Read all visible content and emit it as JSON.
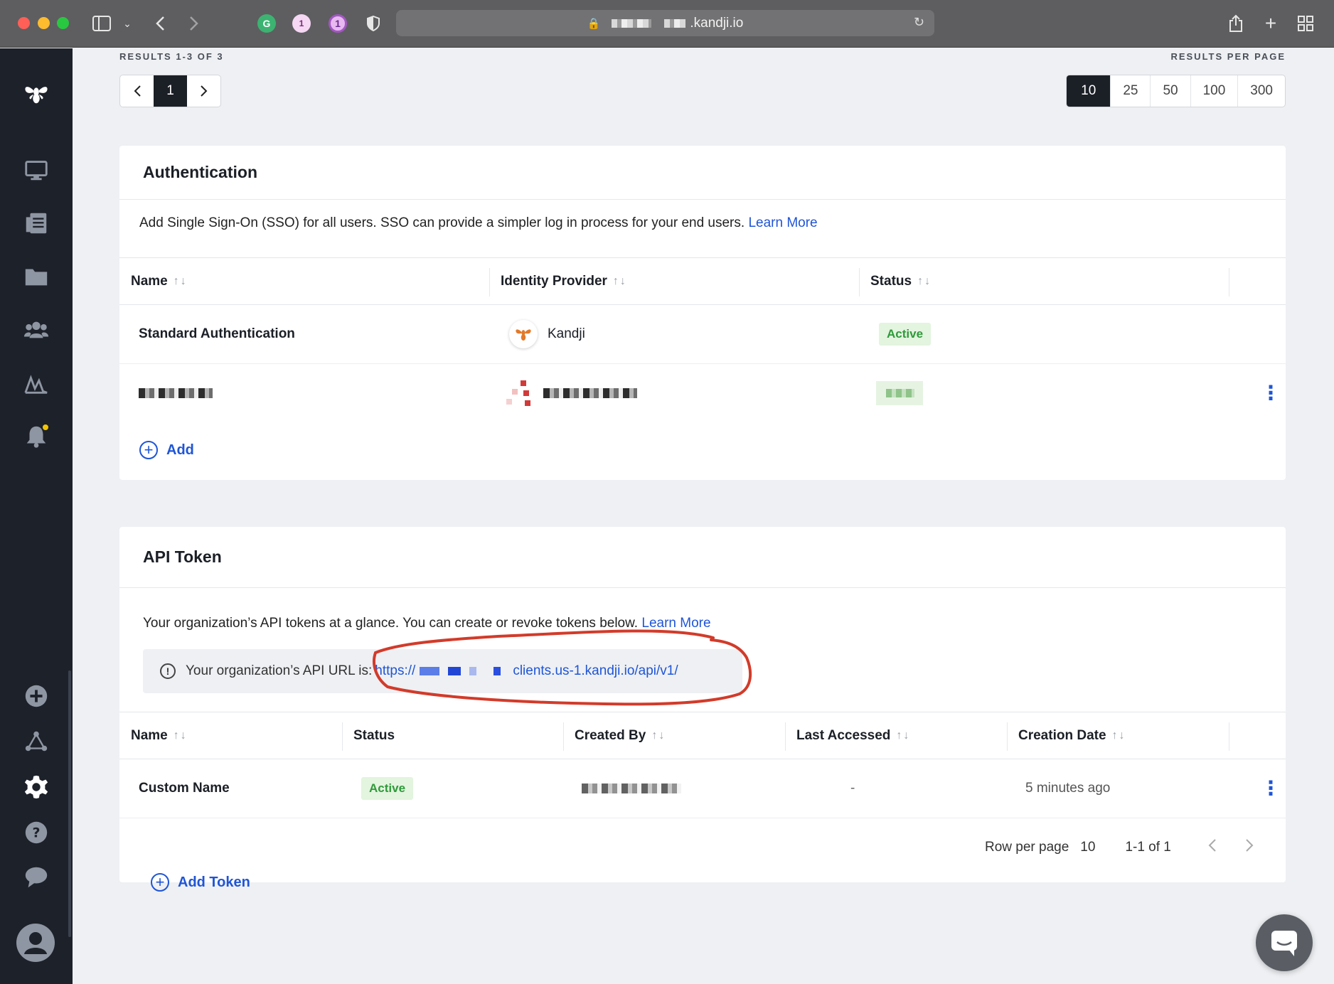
{
  "browser": {
    "url_suffix": ".kandji.io",
    "extensions": [
      "grammarly-icon",
      "one-badge-icon",
      "1password-icon",
      "shield-icon"
    ]
  },
  "sidebar": {
    "items": [
      "computer-icon",
      "library-icon",
      "folder-icon",
      "users-icon",
      "activity-icon",
      "bell-icon",
      "add-icon",
      "integrations-icon",
      "settings-icon",
      "help-icon",
      "chat-icon",
      "avatar-icon"
    ],
    "active": "settings-icon",
    "notification_color": "#f4c400"
  },
  "pagination": {
    "results_label": "RESULTS 1-3 OF 3",
    "current_page": "1",
    "rpp_label": "RESULTS PER PAGE",
    "rpp_options": [
      "10",
      "25",
      "50",
      "100",
      "300"
    ],
    "rpp_selected": "10"
  },
  "auth": {
    "title": "Authentication",
    "desc": "Add Single Sign-On (SSO) for all users. SSO can provide a simpler log in process for your end users.",
    "learn_more": "Learn More",
    "columns": [
      "Name",
      "Identity Provider",
      "Status"
    ],
    "rows": [
      {
        "name": "Standard Authentication",
        "provider": "Kandji",
        "status": "Active"
      }
    ],
    "add_label": "Add"
  },
  "api": {
    "title": "API Token",
    "desc": "Your organization’s API tokens at a glance. You can create or revoke tokens below.",
    "learn_more": "Learn More",
    "url_label": "Your organization’s API URL is:",
    "url_prefix": "https://",
    "url_suffix": "clients.us-1.kandji.io/api/v1/",
    "columns": [
      "Name",
      "Status",
      "Created By",
      "Last Accessed",
      "Creation Date"
    ],
    "rows": [
      {
        "name": "Custom Name",
        "status": "Active",
        "last_accessed": "-",
        "creation_date": "5 minutes ago"
      }
    ],
    "add_label": "Add Token",
    "rows_per_page_label": "Row per page",
    "rows_per_page": "10",
    "range": "1-1 of 1"
  },
  "colors": {
    "accent": "#1f55d6",
    "sidebar_bg": "#1d2129",
    "annotation": "#d23b2a",
    "status_active_bg": "#e3f4df",
    "status_active_text": "#2f9a3a"
  }
}
